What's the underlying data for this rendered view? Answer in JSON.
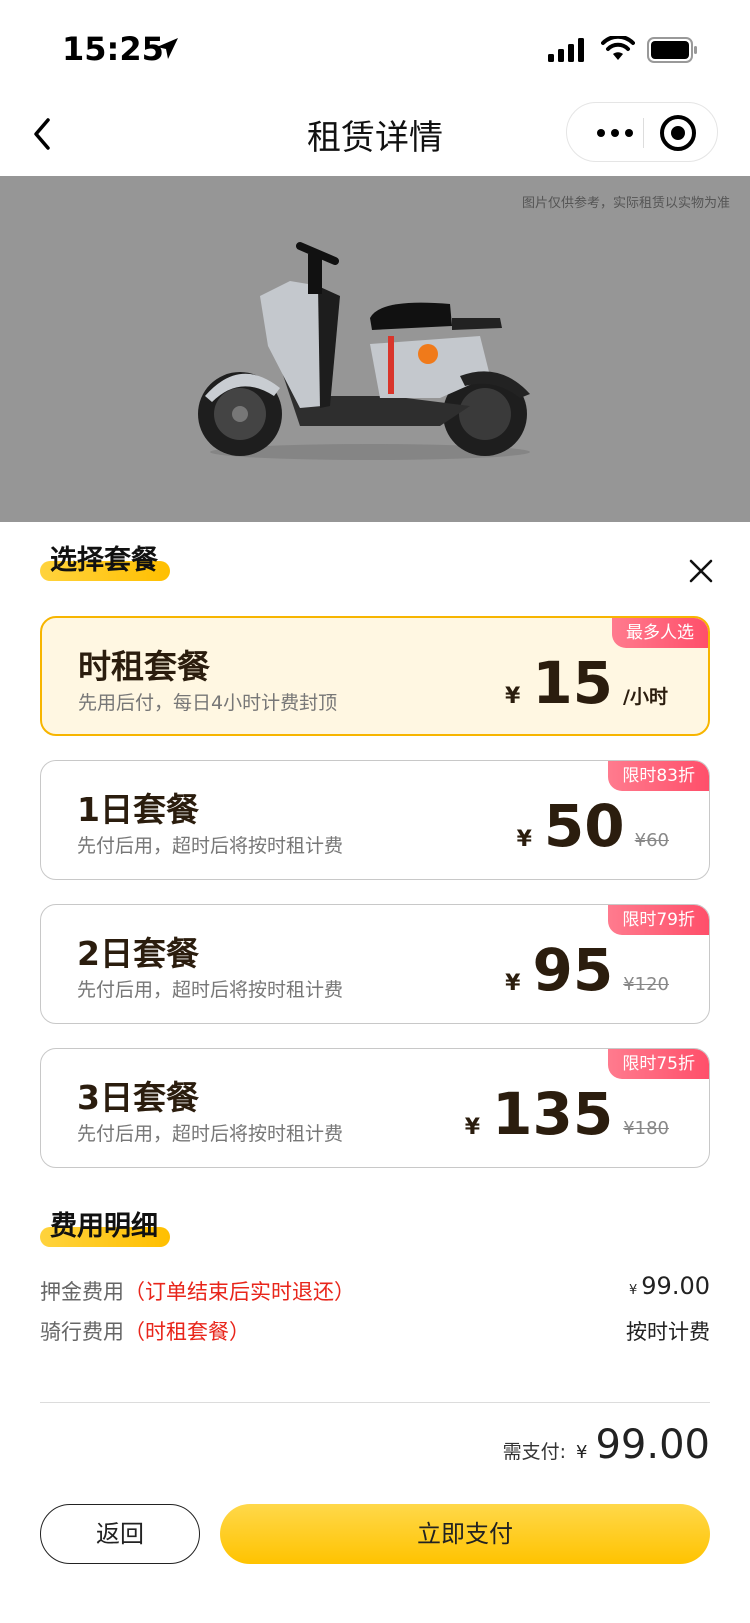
{
  "status": {
    "time": "15:25"
  },
  "nav": {
    "title": "租赁详情"
  },
  "hero": {
    "note": "图片仅供参考，实际租赁以实物为准"
  },
  "plans_section": {
    "title": "选择套餐"
  },
  "plans": [
    {
      "name": "时租套餐",
      "desc": "先用后付，每日4小时计费封顶",
      "badge": "最多人选",
      "currency": "¥",
      "price": "15",
      "unit": "/小时",
      "original": "",
      "selected": true
    },
    {
      "name": "1日套餐",
      "desc": "先付后用，超时后将按时租计费",
      "badge": "限时83折",
      "currency": "¥",
      "price": "50",
      "unit": "",
      "original": "¥60",
      "selected": false
    },
    {
      "name": "2日套餐",
      "desc": "先付后用，超时后将按时租计费",
      "badge": "限时79折",
      "currency": "¥",
      "price": "95",
      "unit": "",
      "original": "¥120",
      "selected": false
    },
    {
      "name": "3日套餐",
      "desc": "先付后用，超时后将按时租计费",
      "badge": "限时75折",
      "currency": "¥",
      "price": "135",
      "unit": "",
      "original": "¥180",
      "selected": false
    }
  ],
  "fees_section": {
    "title": "费用明细"
  },
  "fees": [
    {
      "label": "押金费用",
      "note": "（订单结束后实时退还）",
      "currency": "¥",
      "value": "99.00"
    },
    {
      "label": "骑行费用",
      "note": "（时租套餐）",
      "currency": "",
      "value": "按时计费"
    }
  ],
  "total": {
    "label": "需支付:",
    "currency": "¥",
    "value": "99.00"
  },
  "buttons": {
    "back": "返回",
    "pay": "立即支付"
  },
  "colors": {
    "accent": "#ffc300",
    "badge": "#ff5a72",
    "selected_bg": "#fff7e2",
    "red_note": "#e8251a"
  },
  "icons": [
    "location-arrow-icon",
    "signal-icon",
    "wifi-icon",
    "battery-icon",
    "back-chevron-icon",
    "more-icon",
    "target-icon",
    "close-icon"
  ]
}
